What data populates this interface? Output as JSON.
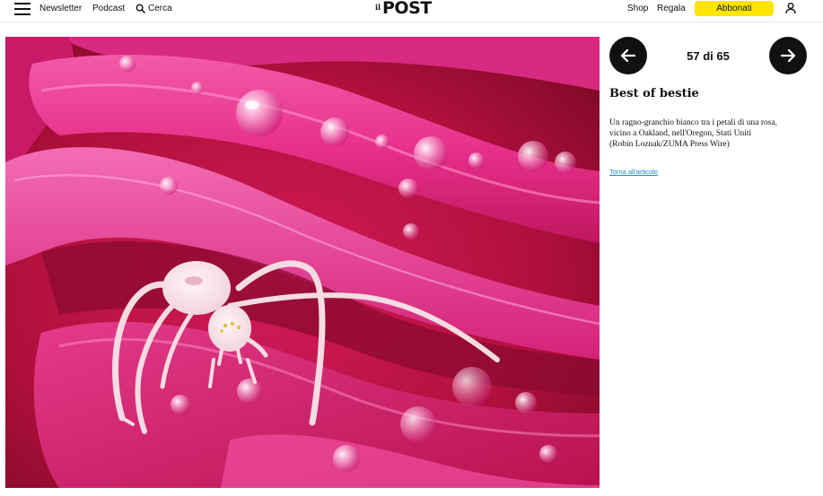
{
  "header": {
    "nav_left": {
      "newsletter": "Newsletter",
      "podcast": "Podcast",
      "search": "Cerca"
    },
    "logo": {
      "il": "il",
      "post": "POST"
    },
    "nav_right": {
      "shop": "Shop",
      "regala": "Regala",
      "subscribe": "Abbonati"
    },
    "subscribe_color": "#ffe500"
  },
  "photo": {
    "alt": "Un ragno-granchio bianco tra i petali di una rosa"
  },
  "gallery": {
    "counter": "57 di 65",
    "title": "Best of bestie",
    "caption_lines": [
      "Un ragno-granchio bianco tra i petali di una rosa,",
      "vicino a Oakland, nell'Oregon, Stati Uniti",
      "(Robin Loznak/ZUMA Press Wire)"
    ],
    "back_link": "Torna all'articolo",
    "link_color": "#1a8ac7"
  },
  "icons": {
    "menu": "hamburger-menu-icon",
    "search": "search-icon",
    "user": "user-icon",
    "prev": "arrow-left-icon",
    "next": "arrow-right-icon"
  }
}
